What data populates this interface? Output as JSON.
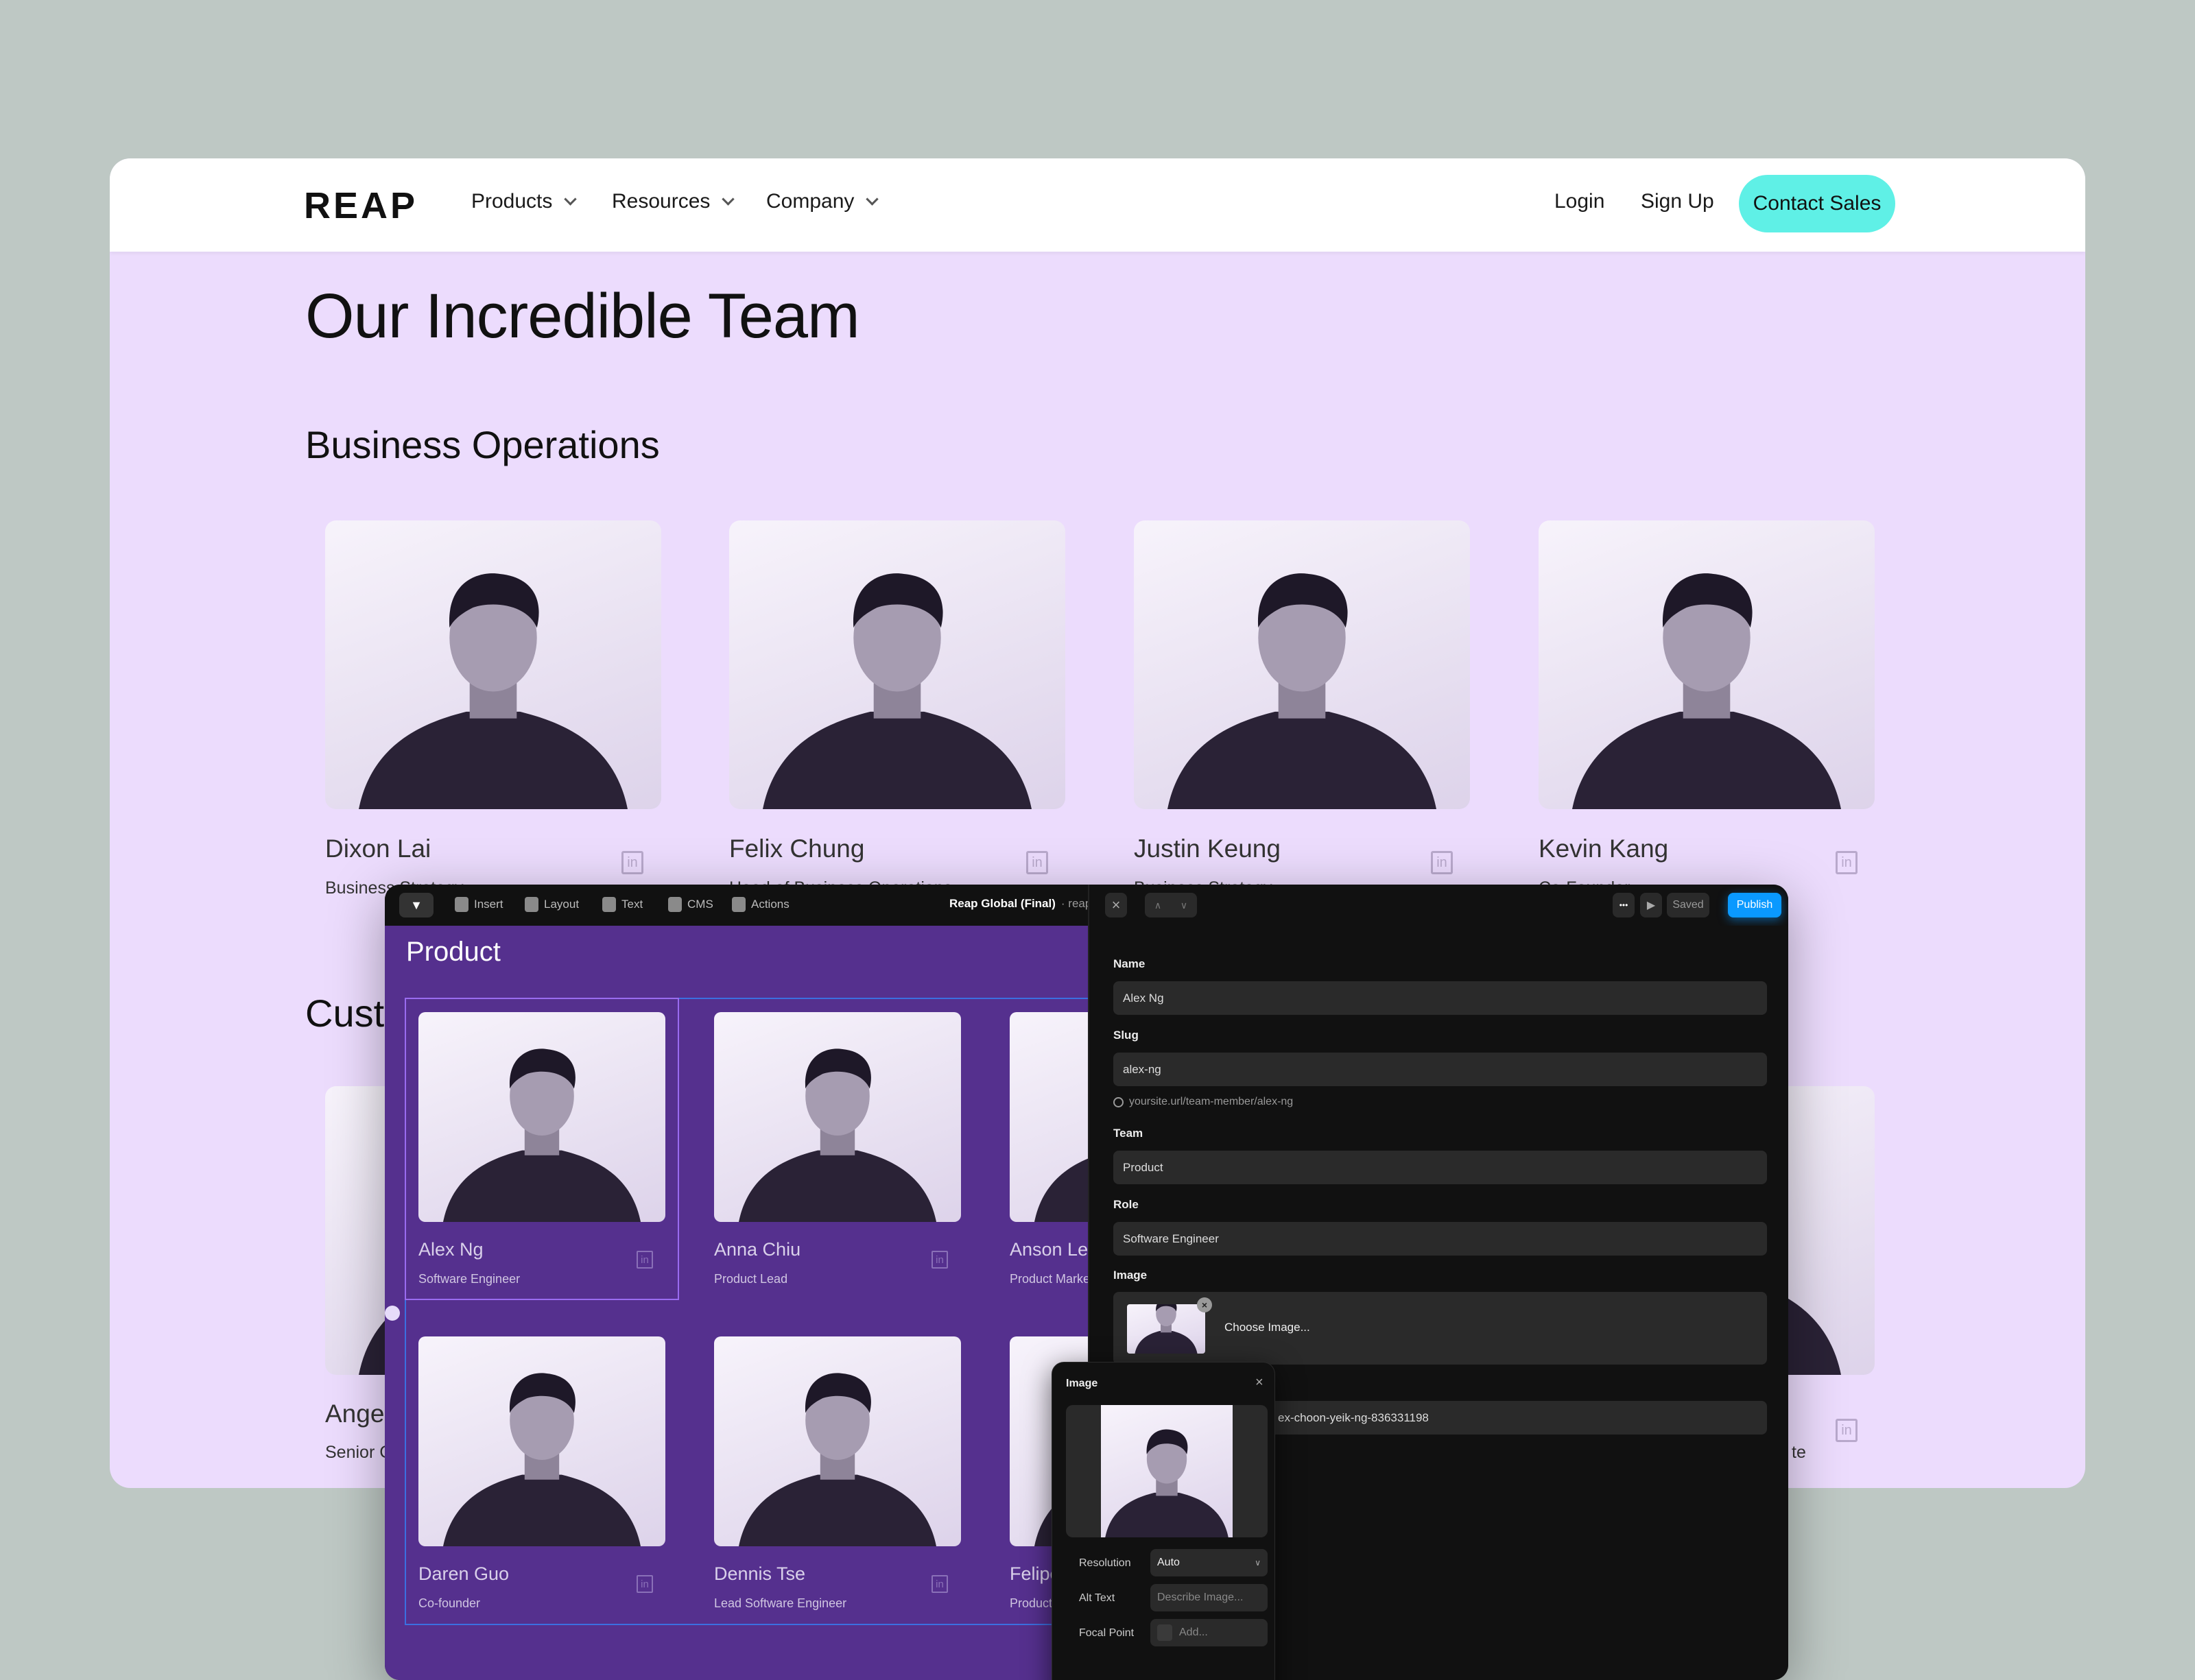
{
  "site": {
    "logo": "REAP",
    "nav": [
      {
        "label": "Products"
      },
      {
        "label": "Resources"
      },
      {
        "label": "Company"
      }
    ],
    "login": "Login",
    "signup": "Sign Up",
    "contact_sales": "Contact Sales",
    "accent_color": "#5ff0e6",
    "page_title": "Our Incredible Team",
    "sections": [
      {
        "title": "Business Operations",
        "members": [
          {
            "name": "Dixon Lai",
            "role": "Business Strategy"
          },
          {
            "name": "Felix Chung",
            "role": "Head of Business Operations"
          },
          {
            "name": "Justin Keung",
            "role": "Business Strategy"
          },
          {
            "name": "Kevin Kang",
            "role": "Co-Founder"
          }
        ]
      },
      {
        "title": "Custo",
        "members": [
          {
            "name": "Ange",
            "role": "Senior C"
          },
          {
            "name": "",
            "role": "te"
          }
        ]
      }
    ]
  },
  "editor": {
    "toolbar": {
      "items": [
        {
          "label": "Insert",
          "icon": "plus-icon"
        },
        {
          "label": "Layout",
          "icon": "layout-icon"
        },
        {
          "label": "Text",
          "icon": "text-icon"
        },
        {
          "label": "CMS",
          "icon": "database-icon"
        },
        {
          "label": "Actions",
          "icon": "bolt-icon"
        }
      ],
      "project_title": "Reap Global (Final)",
      "project_suffix": "· reapg",
      "close": "×",
      "more": "•••",
      "saved": "Saved",
      "publish": "Publish",
      "publish_color": "#0a99ff"
    },
    "canvas": {
      "section_title": "Product",
      "bg_color": "#55308e",
      "members": [
        {
          "name": "Alex Ng",
          "role": "Software Engineer"
        },
        {
          "name": "Anna Chiu",
          "role": "Product Lead"
        },
        {
          "name": "Anson Leu",
          "role": "Product Marke"
        },
        {
          "name": "Daren Guo",
          "role": "Co-founder"
        },
        {
          "name": "Dennis Tse",
          "role": "Lead Software Engineer"
        },
        {
          "name": "Felipe",
          "role": "Product"
        }
      ]
    },
    "panel": {
      "name_label": "Name",
      "name_value": "Alex Ng",
      "slug_label": "Slug",
      "slug_value": "alex-ng",
      "url_preview": "yoursite.url/team-member/alex-ng",
      "team_label": "Team",
      "team_value": "Product",
      "role_label": "Role",
      "role_value": "Software Engineer",
      "image_label": "Image",
      "choose_image": "Choose Image...",
      "link_value": "ex-choon-yeik-ng-836331198"
    },
    "image_popup": {
      "title": "Image",
      "close": "×",
      "resolution_label": "Resolution",
      "resolution_value": "Auto",
      "alt_label": "Alt Text",
      "alt_placeholder": "Describe Image...",
      "focal_label": "Focal Point",
      "focal_placeholder": "Add..."
    }
  }
}
